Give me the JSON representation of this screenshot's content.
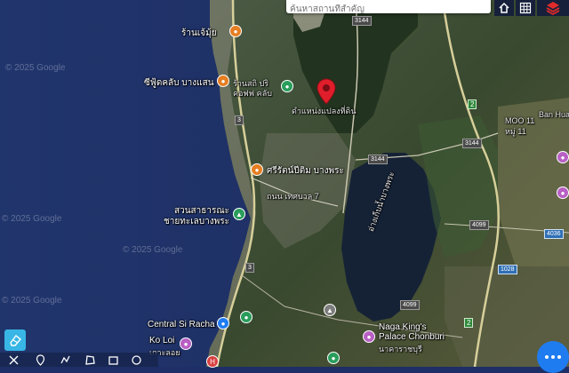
{
  "search": {
    "placeholder": "ค้นหาสถานที่สำคัญ"
  },
  "watermarks": [
    "© 2025 Google",
    "© 2025 Google",
    "© 2025 Google",
    "© 2025 Google"
  ],
  "places": {
    "shop_top": "ร้านเจ้มุ้ย",
    "club_bangsaen": "ซีฟู้ดคลับ บางแสน",
    "cafe_rows": [
      "ร้านสถิ ปริ",
      "คอฟฟ คลับ"
    ],
    "selected_land": "ดำแหน่งแปลงที่ดิน",
    "market_bangphra": "ศรีรัตน์ปีติม บางพระ",
    "park": [
      "สวนสาธารณะ",
      "ชายทะเลบางพระ"
    ],
    "street": "ถนน เทศบาล 7",
    "reservoir": "อ่างเก็บน้ำบางพระ",
    "central": "Central Si Racha",
    "koloi": [
      "Ko Loi",
      "เกาะลอย"
    ],
    "naga": [
      "Naga King's",
      "Palace Chonburi"
    ],
    "naga_thai": "นาคาราชบุรี",
    "moo11": [
      "MOO 11",
      "หมู่ 11"
    ],
    "ban_hua": "Ban Hua"
  },
  "road_shields": {
    "r3144_a": "3144",
    "r3144_b": "3144",
    "r3144_c": "3144",
    "r2_a": "2",
    "r2_b": "2",
    "r3_a": "3",
    "r3_b": "3",
    "r4099_a": "4099",
    "r4099_b": "4099",
    "r4036": "4036",
    "r1028": "1028"
  },
  "colors": {
    "sea": "#1d2f66",
    "land_dark": "#2b3a28",
    "land_green": "#3b5430",
    "reservoir": "#152236",
    "marker": "#e01e2b",
    "accent_blue": "#1f7cf0",
    "eraser_blue": "#38b6e6"
  },
  "icons": {
    "top_buttons": [
      "home-icon",
      "grid-icon",
      "layers-icon"
    ],
    "tools": [
      "measure-icon",
      "pin-icon",
      "polyline-icon",
      "polygon-icon",
      "rectangle-icon",
      "circle-icon"
    ],
    "eraser": "eraser-icon",
    "more": "more-options-icon"
  }
}
